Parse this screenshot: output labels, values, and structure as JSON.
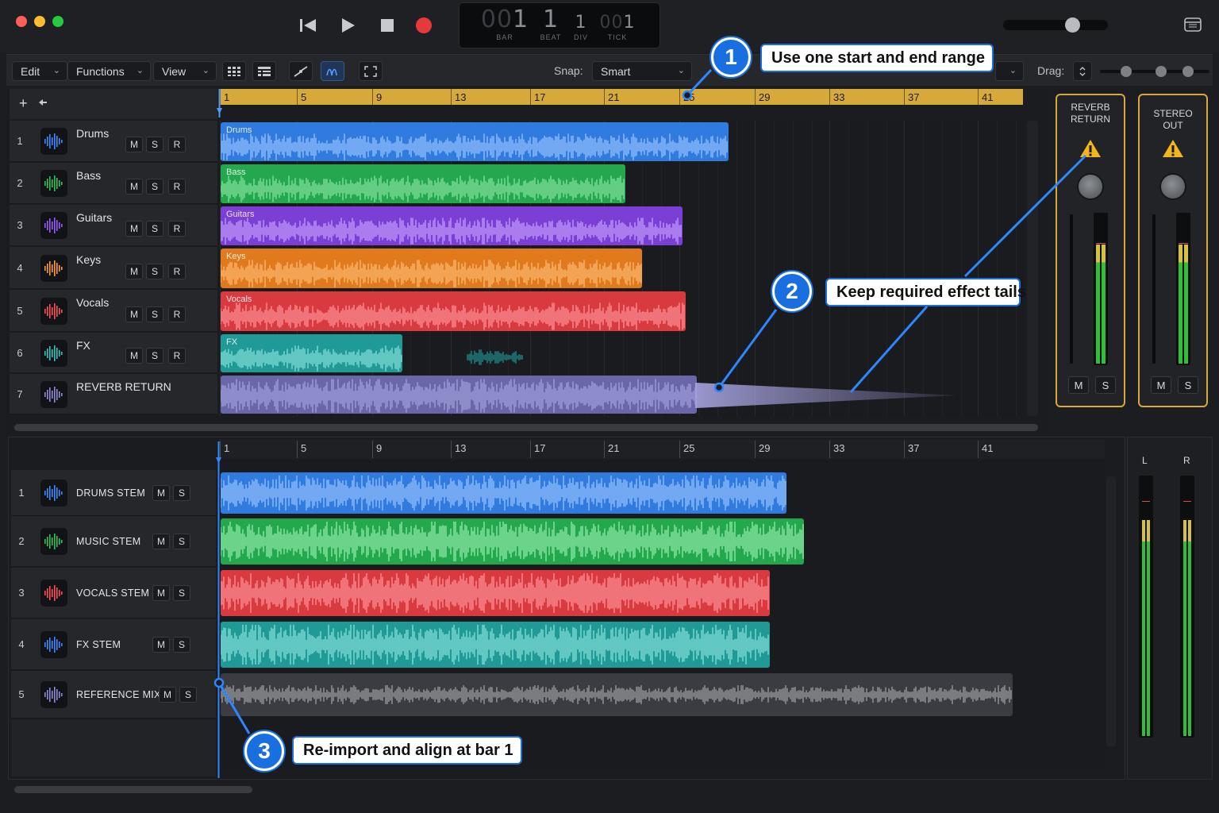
{
  "transport": {
    "lcd": {
      "bar": {
        "dim": "00",
        "val": "1",
        "label": "BAR"
      },
      "beat": {
        "val": "1",
        "label": "BEAT"
      },
      "div": {
        "val": "1",
        "label": "DIV"
      },
      "tick": {
        "dim": "00",
        "val": "1",
        "label": "TICK"
      }
    }
  },
  "toolbar": {
    "edit": "Edit",
    "functions": "Functions",
    "view": "View",
    "snap_label": "Snap:",
    "snap_value": "Smart",
    "drag_label": "Drag:"
  },
  "ruler_marks": [
    "1",
    "5",
    "9",
    "13",
    "17",
    "21",
    "25",
    "29",
    "33",
    "37",
    "41"
  ],
  "tracks": [
    {
      "num": "1",
      "name": "Drums",
      "region": "Drums",
      "color": "#2f7be0",
      "wave": "#9fc8ff",
      "buttons": [
        "M",
        "S",
        "R"
      ]
    },
    {
      "num": "2",
      "name": "Bass",
      "region": "Bass",
      "color": "#23a84d",
      "wave": "#8ee8a8",
      "buttons": [
        "M",
        "S",
        "R"
      ]
    },
    {
      "num": "3",
      "name": "Guitars",
      "region": "Guitars",
      "color": "#7b3fd6",
      "wave": "#c9a6ff",
      "buttons": [
        "M",
        "S",
        "R"
      ]
    },
    {
      "num": "4",
      "name": "Keys",
      "region": "Keys",
      "color": "#e07a1c",
      "wave": "#ffc17a",
      "buttons": [
        "M",
        "S",
        "R"
      ]
    },
    {
      "num": "5",
      "name": "Vocals",
      "region": "Vocals",
      "color": "#d83a3f",
      "wave": "#ff9aa0",
      "buttons": [
        "M",
        "S",
        "R"
      ]
    },
    {
      "num": "6",
      "name": "FX",
      "region": "FX",
      "color": "#1f9a96",
      "wave": "#8fe6e0",
      "buttons": [
        "M",
        "S",
        "R"
      ]
    },
    {
      "num": "7",
      "name": "REVERB RETURN",
      "region": "",
      "color": "#6a67a8",
      "wave": "#a7a4e0",
      "buttons": []
    }
  ],
  "icon_colors": [
    "#3a8bff",
    "#2ec25a",
    "#9a5cff",
    "#ff9a2e",
    "#ff4c55",
    "#2ec7c0",
    "#8f8cd6"
  ],
  "mixer": {
    "strips": [
      {
        "title": "REVERB RETURN",
        "buttons": [
          "M",
          "S"
        ]
      },
      {
        "title": "STEREO OUT",
        "buttons": [
          "M",
          "S"
        ]
      }
    ]
  },
  "stems": [
    {
      "num": "1",
      "name": "DRUMS STEM",
      "color": "#2f7be0",
      "wave": "#9fc8ff",
      "buttons": [
        "M",
        "S"
      ]
    },
    {
      "num": "2",
      "name": "MUSIC STEM",
      "color": "#23a84d",
      "wave": "#9cf0b3",
      "buttons": [
        "M",
        "S"
      ]
    },
    {
      "num": "3",
      "name": "VOCALS STEM",
      "color": "#d83a3f",
      "wave": "#ff9aa0",
      "buttons": [
        "M",
        "S"
      ]
    },
    {
      "num": "4",
      "name": "FX STEM",
      "color": "#1f9a96",
      "wave": "#8fe6e0",
      "buttons": [
        "M",
        "S"
      ]
    },
    {
      "num": "5",
      "name": "REFERENCE MIX",
      "color": "#3b3c41",
      "wave": "#a3a6ab",
      "buttons": [
        "M",
        "S"
      ]
    }
  ],
  "stem_icon_colors": [
    "#3a8bff",
    "#2ec25a",
    "#ff4c55",
    "#3a8bff",
    "#8f8cd6"
  ],
  "master": {
    "left": "L",
    "right": "R"
  },
  "callouts": [
    {
      "num": "1",
      "text": "Use one start and end range"
    },
    {
      "num": "2",
      "text": "Keep required effect tails"
    },
    {
      "num": "3",
      "text": "Re-import and align at bar 1"
    }
  ]
}
